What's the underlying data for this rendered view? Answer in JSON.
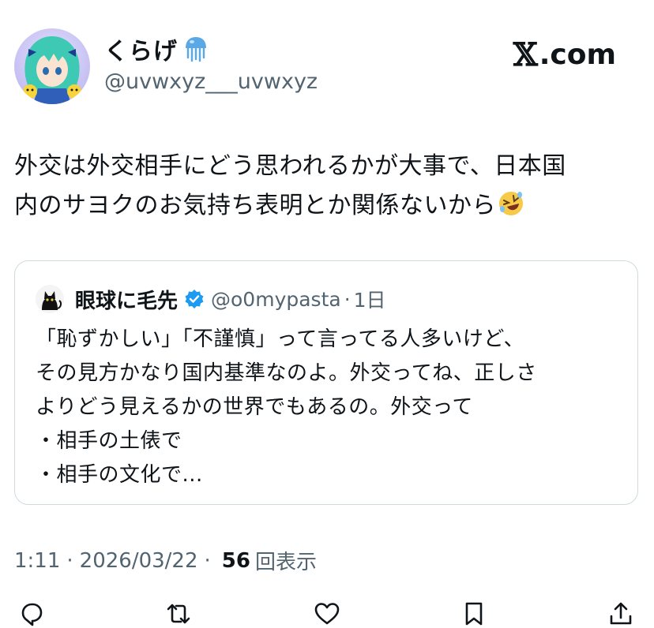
{
  "header": {
    "display_name": "くらげ",
    "name_emoji": "jellyfish-icon",
    "handle": "@uvwxyz___uvwxyz",
    "site_logo": "𝕏",
    "site_name": ".com"
  },
  "tweet": {
    "lines": [
      "外交は外交相手にどう思われるかが大事で、日本国",
      "内のサヨクのお気持ち表明とか関係ないから"
    ],
    "trailing_emoji": "rolling-on-floor-laughing-icon"
  },
  "quote": {
    "name": "眼球に毛先",
    "verified": true,
    "handle": "@o0mypasta",
    "dot": "·",
    "time": "1日",
    "lines": [
      "「恥ずかしい」「不謹慎」って言ってる人多いけど、",
      "その見方かなり国内基準なのよ。外交ってね、正しさ",
      "よりどう見えるかの世界でもあるの。外交って",
      "・相手の土俵で",
      "・相手の文化で..."
    ]
  },
  "meta": {
    "time": "1:11",
    "sep1": "·",
    "date": "2026/03/22",
    "sep2": "·",
    "views_count": "56",
    "views_label": "回表示"
  },
  "actions": [
    "reply-icon",
    "retweet-icon",
    "like-icon",
    "bookmark-icon",
    "share-icon"
  ],
  "colors": {
    "text": "#0f1419",
    "secondary": "#536471",
    "border": "#cfd9de",
    "verified": "#1d9bf0"
  }
}
